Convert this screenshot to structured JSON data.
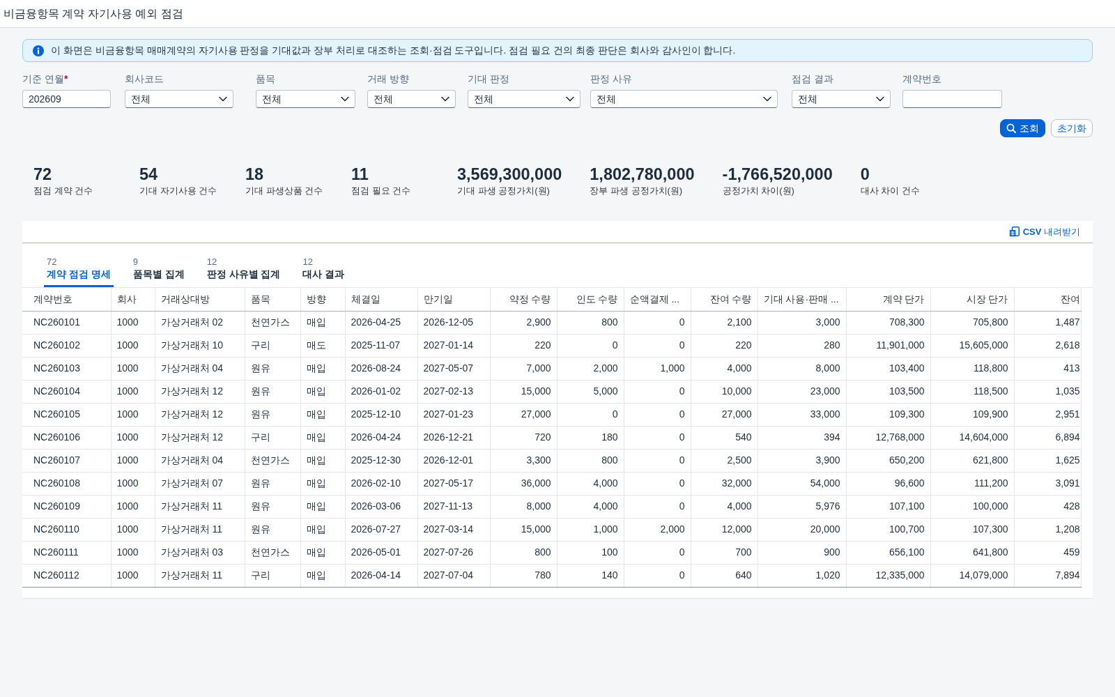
{
  "title": "비금융항목 계약 자기사용 예외 점검",
  "notice": {
    "text": "이 화면은 비금융항목 매매계약의 자기사용 판정을 기대값과 장부 처리로 대조하는 조회·점검 도구입니다. 점검 필요 건의 최종 판단은 회사와 감사인이 합니다."
  },
  "filters": [
    {
      "label": "기준 연월",
      "required_mark": "*",
      "kind": "input",
      "value": "202609"
    },
    {
      "label": "회사코드",
      "kind": "select",
      "value": "전체"
    },
    {
      "label": "품목",
      "kind": "select",
      "value": "전체"
    },
    {
      "label": "거래 방향",
      "kind": "select",
      "value": "전체"
    },
    {
      "label": "기대 판정",
      "kind": "select",
      "value": "전체"
    },
    {
      "label": "판정 사유",
      "kind": "select",
      "value": "전체"
    },
    {
      "label": "점검 결과",
      "kind": "select",
      "value": "전체"
    },
    {
      "label": "계약번호",
      "kind": "input"
    }
  ],
  "actions": [
    {
      "label": "조회",
      "kind": "primary"
    },
    {
      "label": "초기화",
      "kind": "secondary"
    }
  ],
  "kpis": [
    {
      "value": "72",
      "label": "점검 계약 건수"
    },
    {
      "value": "54",
      "label": "기대 자기사용 건수"
    },
    {
      "value": "18",
      "label": "기대 파생상품 건수"
    },
    {
      "value": "11",
      "label": "점검 필요 건수"
    },
    {
      "value": "3,569,300,000",
      "label": "기대 파생 공정가치(원)"
    },
    {
      "value": "1,802,780,000",
      "label": "장부 파생 공정가치(원)"
    },
    {
      "value": "-1,766,520,000",
      "label": "공정가치 차이(원)"
    },
    {
      "value": "0",
      "label": "대사 차이 건수"
    }
  ],
  "panel": {
    "export_button": "**CSV** 내려받기",
    "tabs": [
      {
        "count": "72",
        "label": "계약 점검 명세",
        "selected": true
      },
      {
        "count": "9",
        "label": "품목별 집계",
        "selected": false
      },
      {
        "count": "12",
        "label": "판정 사유별 집계",
        "selected": false
      },
      {
        "count": "12",
        "label": "대사 결과",
        "selected": false
      }
    ],
    "table": {
      "columns": [
        {
          "label": "계약번호",
          "kind": "text"
        },
        {
          "label": "회사",
          "kind": "text"
        },
        {
          "label": "거래상대방",
          "kind": "text"
        },
        {
          "label": "품목",
          "kind": "text"
        },
        {
          "label": "방향",
          "kind": "text"
        },
        {
          "label": "체결일",
          "kind": "text"
        },
        {
          "label": "만기일",
          "kind": "text"
        },
        {
          "label": "약정 수량",
          "kind": "number"
        },
        {
          "label": "인도 수량",
          "kind": "number"
        },
        {
          "label": "순액결제 ...",
          "kind": "truncated"
        },
        {
          "label": "잔여 수량",
          "kind": "number"
        },
        {
          "label": "기대 사용·판매 ...",
          "kind": "truncated"
        },
        {
          "label": "계약 단가",
          "kind": "number"
        },
        {
          "label": "시장 단가",
          "kind": "number"
        },
        {
          "label": "잔여",
          "kind": "number"
        }
      ],
      "rows": [
        [
          "NC260101",
          "1000",
          "가상거래처 02",
          "천연가스",
          "매입",
          "2026-04-25",
          "2026-12-05",
          "2,900",
          "800",
          "0",
          "2,100",
          "3,000",
          "708,300",
          "705,800",
          "1,487"
        ],
        [
          "NC260102",
          "1000",
          "가상거래처 10",
          "구리",
          "매도",
          "2025-11-07",
          "2027-01-14",
          "220",
          "0",
          "0",
          "220",
          "280",
          "11,901,000",
          "15,605,000",
          "2,618"
        ],
        [
          "NC260103",
          "1000",
          "가상거래처 04",
          "원유",
          "매입",
          "2026-08-24",
          "2027-05-07",
          "7,000",
          "2,000",
          "1,000",
          "4,000",
          "8,000",
          "103,400",
          "118,800",
          "413"
        ],
        [
          "NC260104",
          "1000",
          "가상거래처 12",
          "원유",
          "매입",
          "2026-01-02",
          "2027-02-13",
          "15,000",
          "5,000",
          "0",
          "10,000",
          "23,000",
          "103,500",
          "118,500",
          "1,035"
        ],
        [
          "NC260105",
          "1000",
          "가상거래처 12",
          "원유",
          "매입",
          "2025-12-10",
          "2027-01-23",
          "27,000",
          "0",
          "0",
          "27,000",
          "33,000",
          "109,300",
          "109,900",
          "2,951"
        ],
        [
          "NC260106",
          "1000",
          "가상거래처 12",
          "구리",
          "매입",
          "2026-04-24",
          "2026-12-21",
          "720",
          "180",
          "0",
          "540",
          "394",
          "12,768,000",
          "14,604,000",
          "6,894"
        ],
        [
          "NC260107",
          "1000",
          "가상거래처 04",
          "천연가스",
          "매입",
          "2025-12-30",
          "2026-12-01",
          "3,300",
          "800",
          "0",
          "2,500",
          "3,900",
          "650,200",
          "621,800",
          "1,625"
        ],
        [
          "NC260108",
          "1000",
          "가상거래처 07",
          "원유",
          "매입",
          "2026-02-10",
          "2027-05-17",
          "36,000",
          "4,000",
          "0",
          "32,000",
          "54,000",
          "96,600",
          "111,200",
          "3,091"
        ],
        [
          "NC260109",
          "1000",
          "가상거래처 11",
          "원유",
          "매입",
          "2026-03-06",
          "2027-11-13",
          "8,000",
          "4,000",
          "0",
          "4,000",
          "5,976",
          "107,100",
          "100,000",
          "428"
        ],
        [
          "NC260110",
          "1000",
          "가상거래처 11",
          "원유",
          "매입",
          "2026-07-27",
          "2027-03-14",
          "15,000",
          "1,000",
          "2,000",
          "12,000",
          "20,000",
          "100,700",
          "107,300",
          "1,208"
        ],
        [
          "NC260111",
          "1000",
          "가상거래처 03",
          "천연가스",
          "매입",
          "2026-05-01",
          "2027-07-26",
          "800",
          "100",
          "0",
          "700",
          "900",
          "656,100",
          "641,800",
          "459"
        ],
        [
          "NC260112",
          "1000",
          "가상거래처 11",
          "구리",
          "매입",
          "2026-04-14",
          "2027-07-04",
          "780",
          "140",
          "0",
          "640",
          "1,020",
          "12,335,000",
          "14,079,000",
          "7,894"
        ]
      ]
    }
  }
}
